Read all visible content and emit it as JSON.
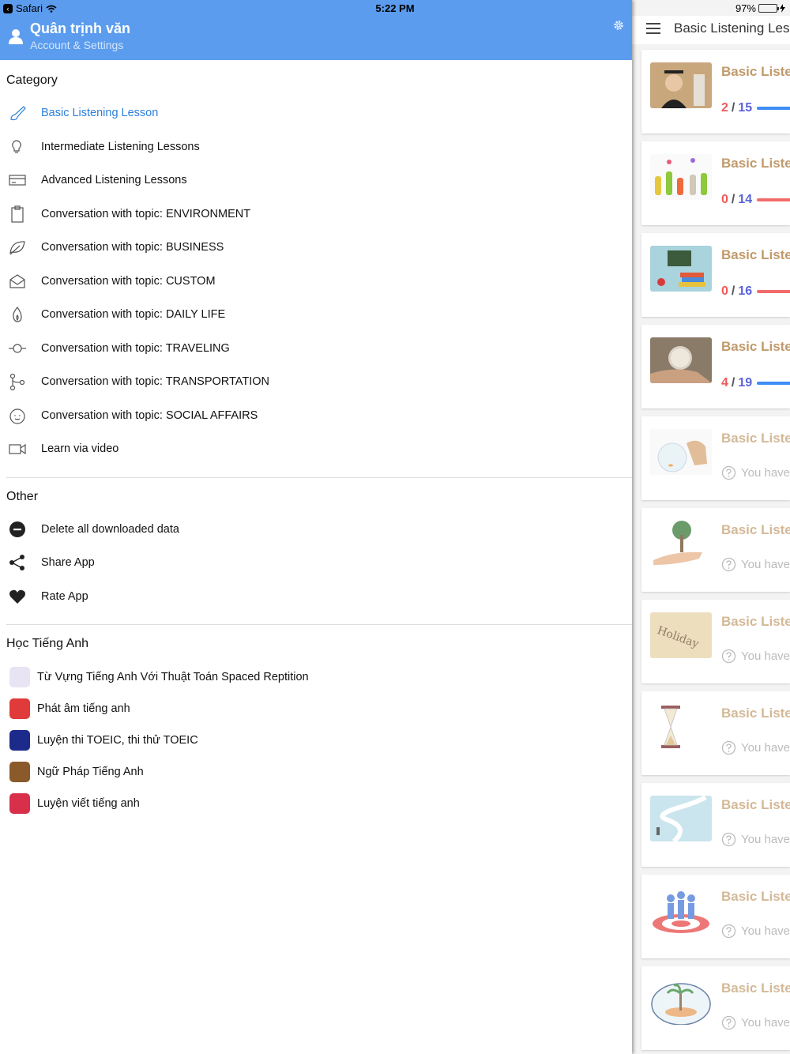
{
  "status": {
    "carrier": "Safari",
    "time": "5:22 PM",
    "battery": "97%"
  },
  "drawer": {
    "user_name": "Quân trịnh văn",
    "user_sub": "Account & Settings",
    "category_title": "Category",
    "categories": [
      {
        "label": "Basic Listening Lesson",
        "icon": "brush-icon",
        "active": true
      },
      {
        "label": "Intermediate Listening Lessons",
        "icon": "bulb-icon"
      },
      {
        "label": "Advanced Listening Lessons",
        "icon": "card-icon"
      },
      {
        "label": "Conversation with topic: ENVIRONMENT",
        "icon": "clipboard-icon"
      },
      {
        "label": "Conversation with topic: BUSINESS",
        "icon": "leaf-icon"
      },
      {
        "label": "Conversation with topic: CUSTOM",
        "icon": "envelope-open-icon"
      },
      {
        "label": "Conversation with topic: DAILY LIFE",
        "icon": "flame-icon"
      },
      {
        "label": "Conversation with topic: TRAVELING",
        "icon": "commit-icon"
      },
      {
        "label": "Conversation with topic: TRANSPORTATION",
        "icon": "branch-icon"
      },
      {
        "label": "Conversation with topic: SOCIAL AFFAIRS",
        "icon": "baby-face-icon"
      },
      {
        "label": "Learn via video",
        "icon": "video-camera-icon"
      }
    ],
    "other_title": "Other",
    "others": [
      {
        "label": "Delete all downloaded data",
        "icon": "minus-circle-icon"
      },
      {
        "label": "Share App",
        "icon": "share-icon"
      },
      {
        "label": "Rate App",
        "icon": "heart-icon"
      }
    ],
    "apps_title": "Học Tiếng Anh",
    "apps": [
      {
        "label": "Từ Vựng Tiếng Anh Với Thuật Toán Spaced Reptition",
        "color": "#e9e4f3"
      },
      {
        "label": "Phát âm tiếng anh",
        "color": "#e03a3a"
      },
      {
        "label": "Luyện thi TOEIC, thi thử TOEIC",
        "color": "#1c2a8a"
      },
      {
        "label": "Ngữ Pháp Tiếng Anh",
        "color": "#8a5a2a"
      },
      {
        "label": "Luyện viết tiếng anh",
        "color": "#d8304a"
      }
    ]
  },
  "main": {
    "title": "Basic Listening Lessons",
    "cards": [
      {
        "title": "Basic Listening",
        "done": "2",
        "total": "15",
        "bar_color": "#3e8ef7",
        "thumb": "graduate-thumb"
      },
      {
        "title": "Basic Listening",
        "done": "0",
        "total": "14",
        "bar_color": "#f26b6b",
        "thumb": "vases-thumb"
      },
      {
        "title": "Basic Listening",
        "done": "0",
        "total": "16",
        "bar_color": "#f26b6b",
        "thumb": "books-thumb"
      },
      {
        "title": "Basic Listening",
        "done": "4",
        "total": "19",
        "bar_color": "#3e8ef7",
        "thumb": "clock-hand-thumb"
      },
      {
        "title": "Basic Listening",
        "none": "You have not",
        "thumb": "cat-fishbowl-thumb"
      },
      {
        "title": "Basic Listening",
        "none": "You have not",
        "thumb": "tree-hand-thumb"
      },
      {
        "title": "Basic Listening",
        "none": "You have not",
        "thumb": "holiday-sand-thumb"
      },
      {
        "title": "Basic Listening",
        "none": "You have not",
        "thumb": "hourglass-thumb"
      },
      {
        "title": "Basic Listening",
        "none": "You have not",
        "thumb": "road-thumb"
      },
      {
        "title": "Basic Listening",
        "none": "You have not",
        "thumb": "people-target-thumb"
      },
      {
        "title": "Basic Listening",
        "none": "You have not",
        "thumb": "island-thumb"
      }
    ]
  }
}
